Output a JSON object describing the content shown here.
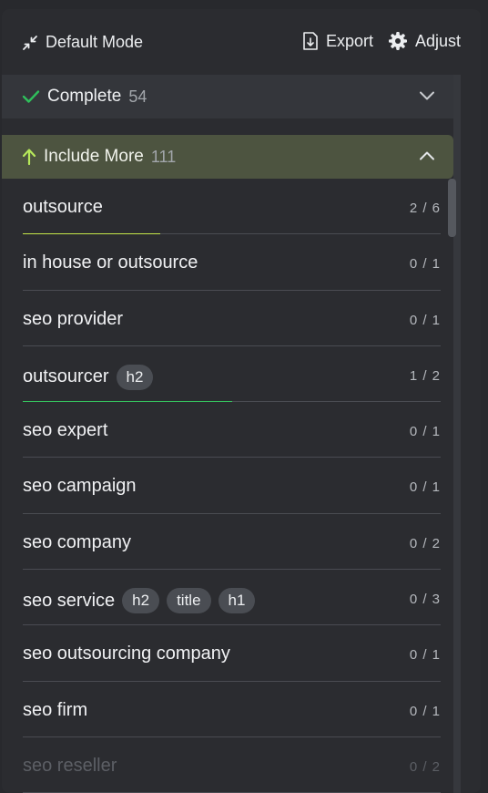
{
  "header": {
    "mode_label": "Default Mode",
    "export_label": "Export",
    "adjust_label": "Adjust"
  },
  "sections": {
    "complete": {
      "label": "Complete",
      "count": "54"
    },
    "include_more": {
      "label": "Include More",
      "count": "111"
    }
  },
  "terms": [
    {
      "term": "outsource",
      "tags": [],
      "ratio": "2 / 6",
      "progress": 0.33,
      "progress_color": "#c5e84a"
    },
    {
      "term": "in house or outsource",
      "tags": [],
      "ratio": "0 / 1"
    },
    {
      "term": "seo provider",
      "tags": [],
      "ratio": "0 / 1"
    },
    {
      "term": "outsourcer",
      "tags": [
        "h2"
      ],
      "ratio": "1 / 2",
      "progress": 0.5,
      "progress_color": "#35c25e"
    },
    {
      "term": "seo expert",
      "tags": [],
      "ratio": "0 / 1"
    },
    {
      "term": "seo campaign",
      "tags": [],
      "ratio": "0 / 1"
    },
    {
      "term": "seo company",
      "tags": [],
      "ratio": "0 / 2"
    },
    {
      "term": "seo service",
      "tags": [
        "h2",
        "title",
        "h1"
      ],
      "ratio": "0 / 3"
    },
    {
      "term": "seo outsourcing company",
      "tags": [],
      "ratio": "0 / 1"
    },
    {
      "term": "seo firm",
      "tags": [],
      "ratio": "0 / 1"
    },
    {
      "term": "seo reseller",
      "tags": [],
      "ratio": "0 / 2",
      "faded": true
    }
  ],
  "colors": {
    "complete_check": "#2fbf5b",
    "include_arrow": "#b6e85a"
  },
  "icons": {
    "mode": "collapse-arrows-icon",
    "export": "export-icon",
    "adjust": "gear-icon",
    "complete": "check-icon",
    "include": "arrow-up-icon"
  }
}
